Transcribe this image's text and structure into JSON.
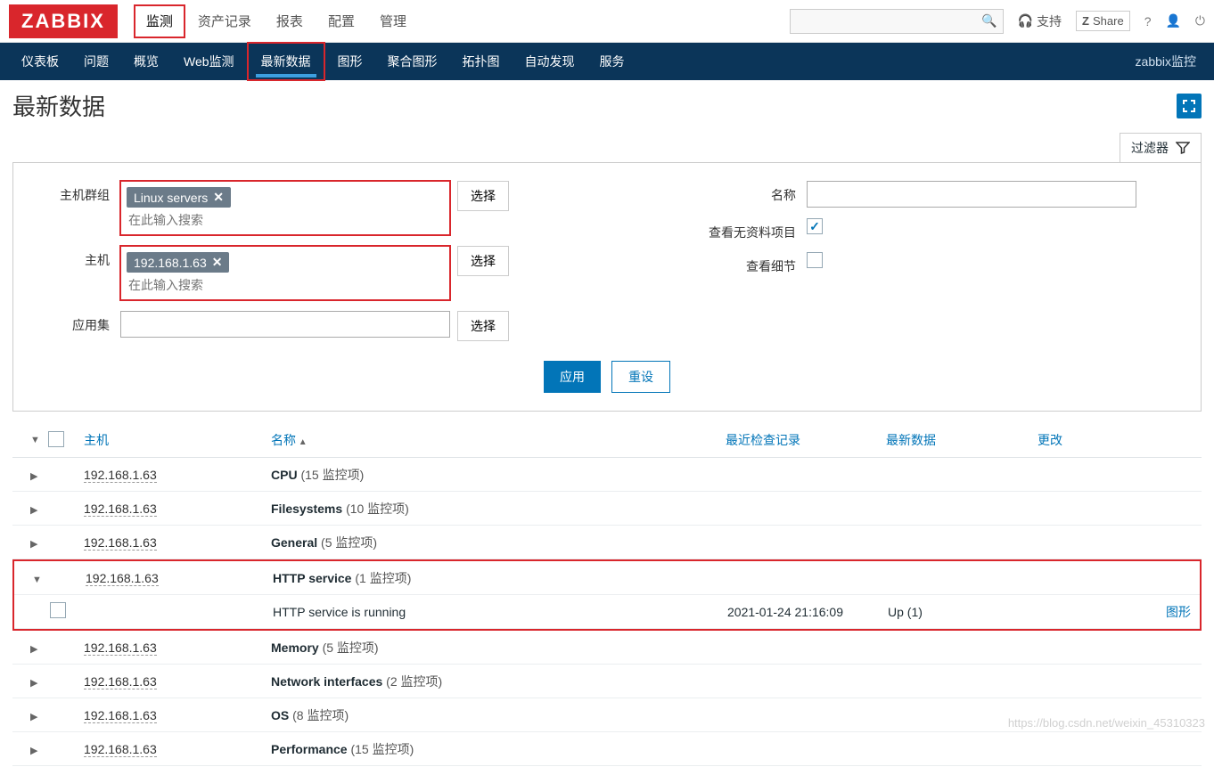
{
  "brand": "ZABBIX",
  "top_tabs": [
    "监测",
    "资产记录",
    "报表",
    "配置",
    "管理"
  ],
  "top_active": 0,
  "support_label": "支持",
  "share_label": "Share",
  "subnav": [
    "仪表板",
    "问题",
    "概览",
    "Web监测",
    "最新数据",
    "图形",
    "聚合图形",
    "拓扑图",
    "自动发现",
    "服务"
  ],
  "subnav_active": 4,
  "subnav_right": "zabbix监控",
  "page_title": "最新数据",
  "filter_tab_label": "过滤器",
  "filter": {
    "labels": {
      "hostgroup": "主机群组",
      "host": "主机",
      "app": "应用集",
      "name": "名称",
      "show_empty": "查看无资料项目",
      "show_detail": "查看细节",
      "select": "选择",
      "apply": "应用",
      "reset": "重设",
      "search_ph": "在此输入搜索"
    },
    "hostgroup_tags": [
      "Linux servers"
    ],
    "host_tags": [
      "192.168.1.63"
    ],
    "show_empty_checked": true,
    "show_detail_checked": false
  },
  "table": {
    "headers": {
      "host": "主机",
      "name": "名称",
      "last": "最近检查记录",
      "data": "最新数据",
      "change": "更改"
    },
    "rows": [
      {
        "host": "192.168.1.63",
        "group": "CPU",
        "count": "(15 监控项)",
        "expanded": false
      },
      {
        "host": "192.168.1.63",
        "group": "Filesystems",
        "count": "(10 监控项)",
        "expanded": false
      },
      {
        "host": "192.168.1.63",
        "group": "General",
        "count": "(5 监控项)",
        "expanded": false
      },
      {
        "host": "192.168.1.63",
        "group": "HTTP service",
        "count": "(1 监控项)",
        "expanded": true,
        "hl": true
      },
      {
        "item": true,
        "name": "HTTP service is running",
        "last": "2021-01-24 21:16:09",
        "data": "Up (1)",
        "action": "图形",
        "hl": true
      },
      {
        "host": "192.168.1.63",
        "group": "Memory",
        "count": "(5 监控项)",
        "expanded": false
      },
      {
        "host": "192.168.1.63",
        "group": "Network interfaces",
        "count": "(2 监控项)",
        "expanded": false
      },
      {
        "host": "192.168.1.63",
        "group": "OS",
        "count": "(8 监控项)",
        "expanded": false
      },
      {
        "host": "192.168.1.63",
        "group": "Performance",
        "count": "(15 监控项)",
        "expanded": false
      }
    ]
  },
  "watermark": "https://blog.csdn.net/weixin_45310323"
}
